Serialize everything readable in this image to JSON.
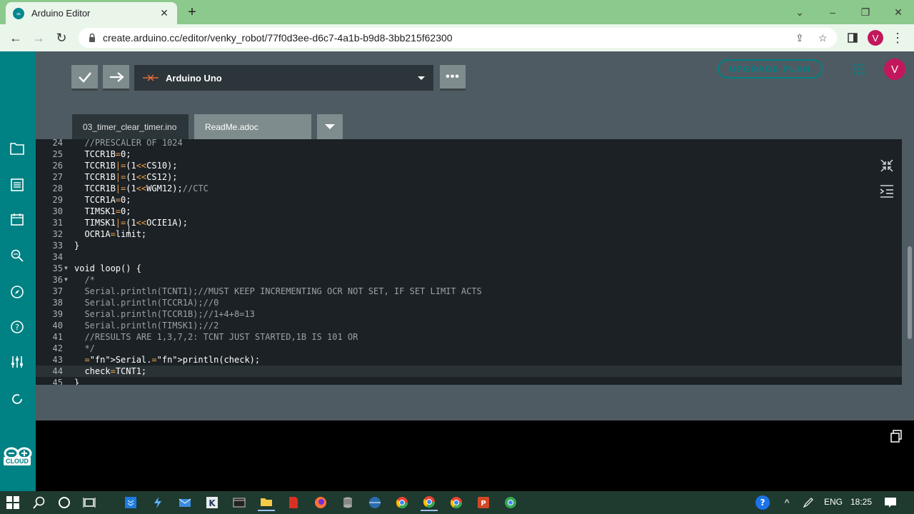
{
  "browser": {
    "tab_title": "Arduino Editor",
    "url": "create.arduino.cc/editor/venky_robot/77f0d3ee-d6c7-4a1b-b9d8-3bb215f62300",
    "profile_initial": "V"
  },
  "toolbar": {
    "board_name": "Arduino Uno",
    "upgrade_label": "UPGRADE PLAN",
    "user_initial": "V"
  },
  "file_tabs": [
    {
      "label": "03_timer_clear_timer.ino"
    },
    {
      "label": "ReadMe.adoc"
    }
  ],
  "sidebar": {
    "cloud_label": "CLOUD"
  },
  "code_lines": [
    {
      "n": "24",
      "text": "  //PRESCALER OF 1024"
    },
    {
      "n": "25",
      "text": "  TCCR1B=0;"
    },
    {
      "n": "26",
      "text": "  TCCR1B|=(1<<CS10);"
    },
    {
      "n": "27",
      "text": "  TCCR1B|=(1<<CS12);"
    },
    {
      "n": "28",
      "text": "  TCCR1B|=(1<<WGM12);//CTC"
    },
    {
      "n": "29",
      "text": "  TCCR1A=0;"
    },
    {
      "n": "30",
      "text": "  TIMSK1=0;"
    },
    {
      "n": "31",
      "text": "  TIMSK1|=(1<<OCIE1A);"
    },
    {
      "n": "32",
      "text": "  OCR1A=limit;"
    },
    {
      "n": "33",
      "text": "}"
    },
    {
      "n": "34",
      "text": ""
    },
    {
      "n": "35",
      "text": "void loop() {"
    },
    {
      "n": "36",
      "text": "  /*"
    },
    {
      "n": "37",
      "text": "  Serial.println(TCNT1);//MUST KEEP INCREMENTING OCR NOT SET, IF SET LIMIT ACTS"
    },
    {
      "n": "38",
      "text": "  Serial.println(TCCR1A);//0"
    },
    {
      "n": "39",
      "text": "  Serial.println(TCCR1B);//1+4+8=13"
    },
    {
      "n": "40",
      "text": "  Serial.println(TIMSK1);//2"
    },
    {
      "n": "41",
      "text": "  //RESULTS ARE 1,3,7,2: TCNT JUST STARTED,1B IS 101 OR"
    },
    {
      "n": "42",
      "text": "  */"
    },
    {
      "n": "43",
      "text": "  Serial.println(check);"
    },
    {
      "n": "44",
      "text": "  check=TCNT1;"
    },
    {
      "n": "45",
      "text": "}"
    }
  ],
  "taskbar": {
    "lang": "ENG",
    "time": "18:25"
  },
  "colors": {
    "teal": "#008184",
    "editor_bg": "#1b2125",
    "panel_bg": "#4f5b62"
  }
}
